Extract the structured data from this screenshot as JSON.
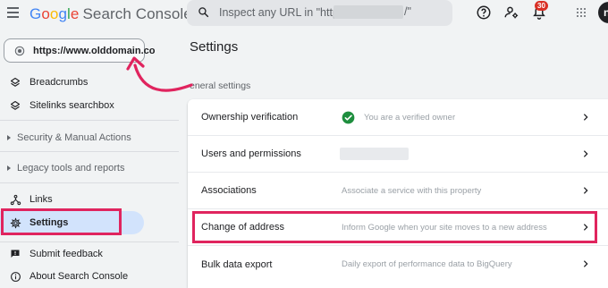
{
  "header": {
    "logo_google": "Google",
    "logo_product": "Search Console",
    "search_placeholder": "Inspect any URL in \"https://",
    "search_suffix": "/\"",
    "notification_count": "30",
    "avatar_letter": "n",
    "icons": [
      "menu-icon",
      "search-icon",
      "help-icon",
      "manage-accounts-icon",
      "notifications-icon",
      "apps-icon"
    ]
  },
  "sidebar": {
    "property_url": "https://www.olddomain.co",
    "items_top": [
      {
        "label": "Breadcrumbs",
        "icon": "layers-icon"
      },
      {
        "label": "Sitelinks searchbox",
        "icon": "layers-icon"
      }
    ],
    "sections": [
      {
        "label": "Security & Manual Actions"
      },
      {
        "label": "Legacy tools and reports"
      }
    ],
    "items_bottom": [
      {
        "label": "Links",
        "icon": "links-icon"
      },
      {
        "label": "Settings",
        "icon": "gear-icon",
        "active": true
      }
    ],
    "items_footer": [
      {
        "label": "Submit feedback",
        "icon": "feedback-icon"
      },
      {
        "label": "About Search Console",
        "icon": "info-icon"
      }
    ]
  },
  "main": {
    "title": "Settings",
    "section_label": "eneral settings",
    "rows": [
      {
        "label": "Ownership verification",
        "desc": "You are a verified owner"
      },
      {
        "label": "Users and permissions",
        "desc": ""
      },
      {
        "label": "Associations",
        "desc": "Associate a service with this property"
      },
      {
        "label": "Change of address",
        "desc": "Inform Google when your site moves to a new address"
      },
      {
        "label": "Bulk data export",
        "desc": "Daily export of performance data to BigQuery"
      }
    ]
  },
  "colors": {
    "highlight": "#e0245e",
    "active_bg": "#d2e3fc",
    "verified_green": "#1e8e3e"
  }
}
